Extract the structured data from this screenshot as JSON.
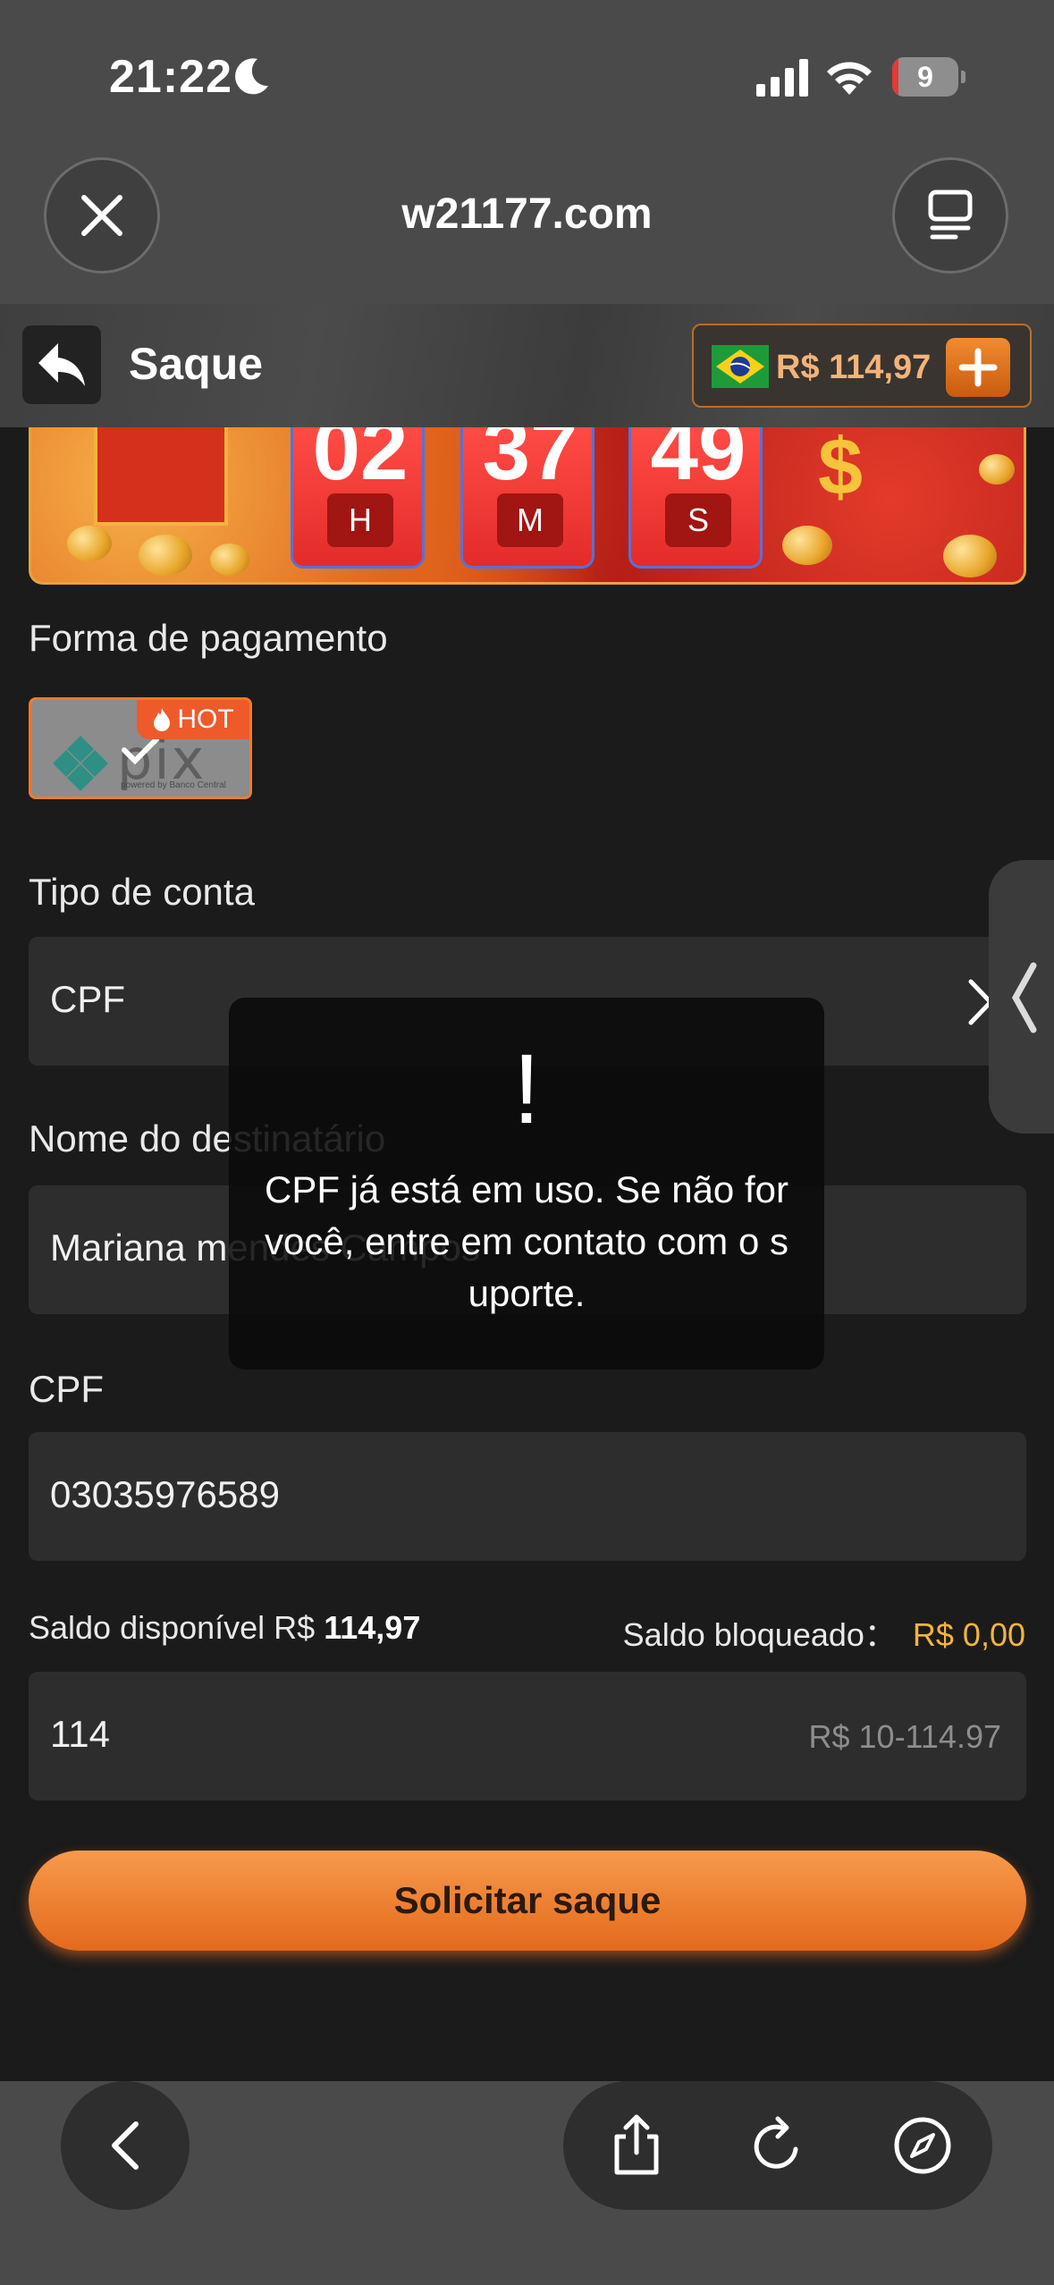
{
  "status_bar": {
    "time": "21:22",
    "battery_level": "9",
    "battery_fraction": 0.09,
    "icons": [
      "moon-icon",
      "signal-icon",
      "wifi-icon",
      "battery-icon"
    ]
  },
  "browser": {
    "url": "w21177.com",
    "close_icon": "close-icon",
    "tabs_icon": "tabs-icon"
  },
  "header": {
    "title": "Saque",
    "back_icon": "back-arrow-icon",
    "balance": "R$ 114,97",
    "flag": "brazil-flag-icon",
    "add_icon": "plus-icon"
  },
  "banner": {
    "hours": "02",
    "hours_unit": "H",
    "minutes": "37",
    "minutes_unit": "M",
    "seconds": "49",
    "seconds_unit": "S",
    "symbol": "$"
  },
  "form": {
    "payment_label": "Forma de pagamento",
    "pix_text": "pix",
    "pix_subtitle": "powered by Banco Central",
    "hot_badge": "HOT",
    "account_type_label": "Tipo de conta",
    "account_type_value": "CPF",
    "recipient_label": "Nome do destinatário",
    "recipient_value": "Mariana mendes Campos",
    "cpf_label": "CPF",
    "cpf_value": "03035976589",
    "available_label": "Saldo disponível R$",
    "available_value": "114,97",
    "blocked_label": "Saldo bloqueado：",
    "blocked_value": "R$ 0,00",
    "amount_value": "114",
    "amount_hint": "R$ 10-114.97",
    "submit_label": "Solicitar saque"
  },
  "toast": {
    "icon": "!",
    "message": "CPF já está em uso. Se não for você, entre em contato com o suporte."
  },
  "bottom_bar": {
    "icons": [
      "back-icon",
      "share-icon",
      "reload-icon",
      "compass-icon"
    ]
  },
  "colors": {
    "accent": "#f07a2b",
    "gold": "#f3b43c",
    "background": "#1b1b1b",
    "field": "#2d2d2d"
  }
}
